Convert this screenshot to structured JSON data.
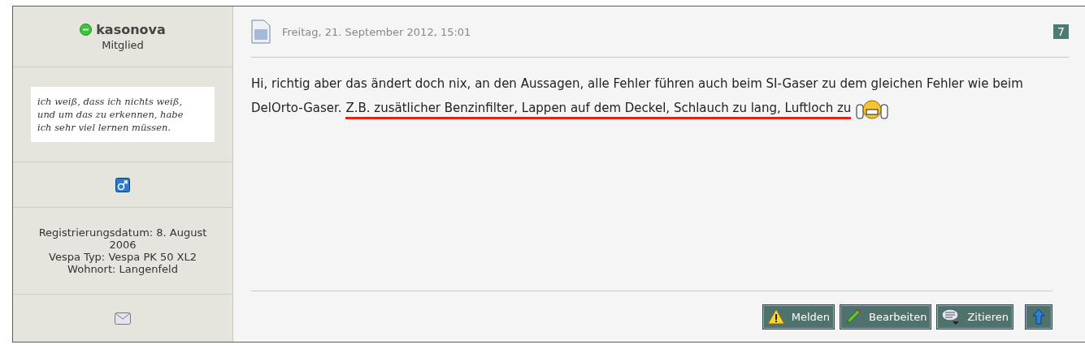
{
  "author": {
    "name": "kasonova",
    "online": true,
    "rank": "Mitglied",
    "signature": [
      "ich weiß, dass ich nichts weiß,",
      "und um das zu erkennen, habe",
      "ich sehr viel lernen müssen."
    ],
    "info": [
      "Registrierungsdatum: 8. August 2006",
      "Vespa Typ: Vespa PK 50 XL2",
      "Wohnort: Langenfeld"
    ]
  },
  "post": {
    "date": "Freitag, 21. September 2012, 15:01",
    "number": "7",
    "message": {
      "text": "Hi, richtig aber das ändert doch nix, an den Aussagen, alle Fehler führen auch beim SI-Gaser zu dem gleichen Fehler wie beim DelOrto-Gaser. ",
      "underlined": "Z.B. zusätlicher Benzinfilter, Lappen auf dem Deckel, Schlauch zu lang, Luftloch zu"
    }
  },
  "buttons": [
    {
      "kind": "report",
      "label": "Melden"
    },
    {
      "kind": "edit",
      "label": "Bearbeiten"
    },
    {
      "kind": "quote",
      "label": "Zitieren"
    },
    {
      "kind": "top"
    }
  ]
}
